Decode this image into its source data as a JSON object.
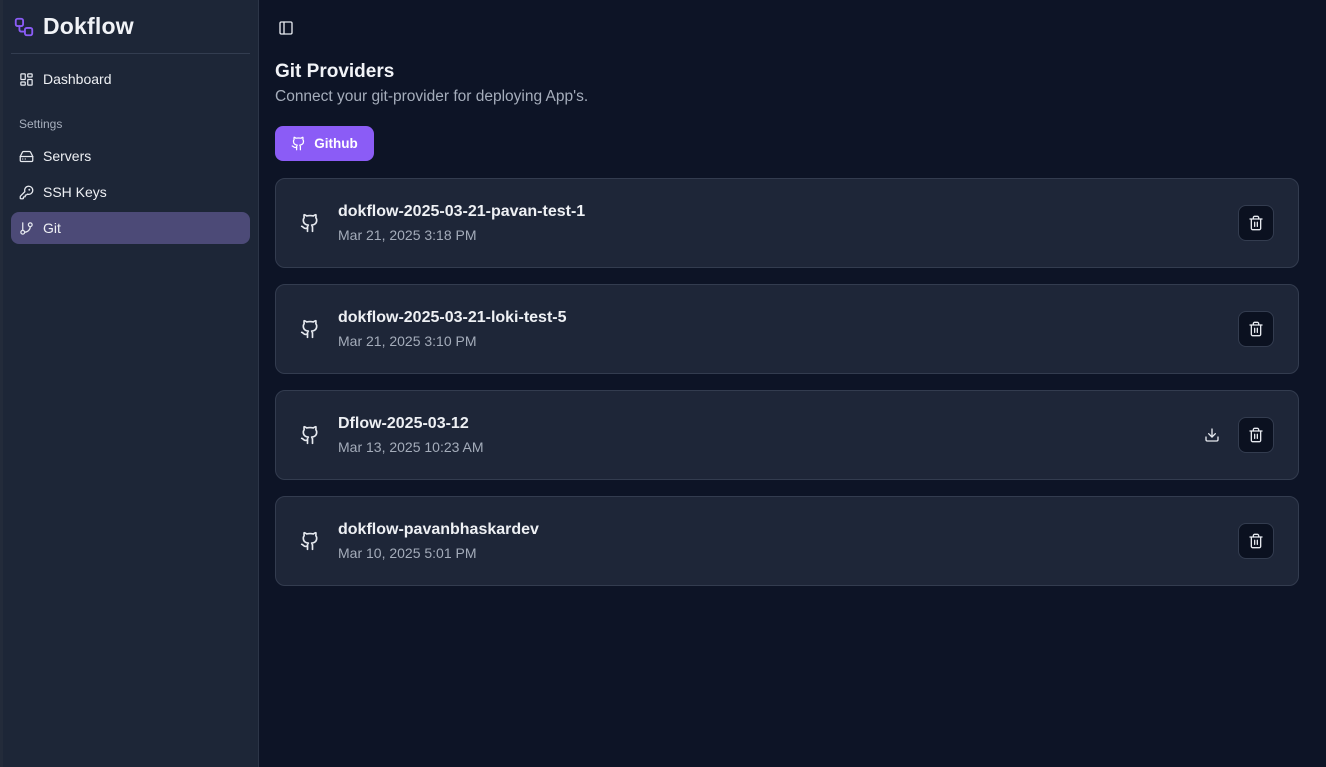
{
  "sidebar": {
    "brand": "Dokflow",
    "nav": {
      "dashboard": "Dashboard"
    },
    "settings_label": "Settings",
    "settings_items": [
      {
        "label": "Servers",
        "icon": "server-icon"
      },
      {
        "label": "SSH Keys",
        "icon": "key-icon"
      },
      {
        "label": "Git",
        "icon": "git-branch-icon",
        "active": true
      }
    ]
  },
  "main": {
    "title": "Git Providers",
    "subtitle": "Connect your git-provider for deploying App's.",
    "github_button": "Github"
  },
  "providers": [
    {
      "name": "dokflow-2025-03-21-pavan-test-1",
      "date": "Mar 21, 2025 3:18 PM",
      "has_download": false
    },
    {
      "name": "dokflow-2025-03-21-loki-test-5",
      "date": "Mar 21, 2025 3:10 PM",
      "has_download": false
    },
    {
      "name": "Dflow-2025-03-12",
      "date": "Mar 13, 2025 10:23 AM",
      "has_download": true
    },
    {
      "name": "dokflow-pavanbhaskardev",
      "date": "Mar 10, 2025 5:01 PM",
      "has_download": false
    }
  ],
  "colors": {
    "accent": "#8b5cf6",
    "background": "#0d1426",
    "sidebar": "#1d2637",
    "active_nav": "#4c4a77"
  }
}
